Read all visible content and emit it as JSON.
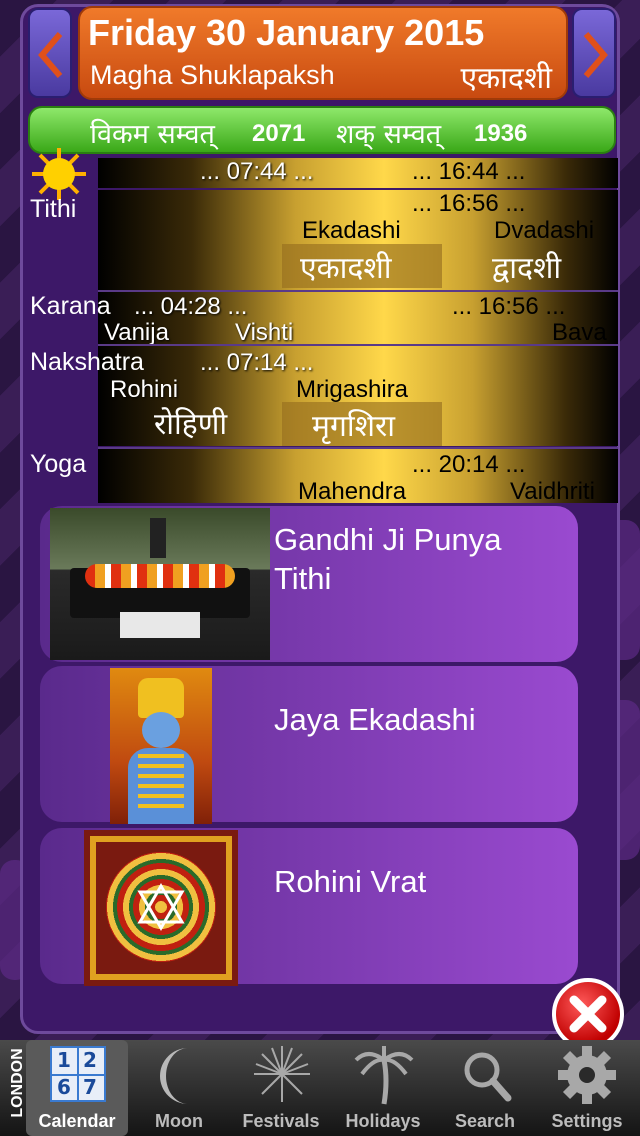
{
  "header": {
    "date": "Friday 30 January 2015",
    "paksha": "Magha Shuklapaksh",
    "tithi_hindi": "एकादशी",
    "samvat_vikram_label": "विकम सम्वत्",
    "samvat_vikram": "2071",
    "samvat_shak_label": "शक् सम्वत्",
    "samvat_shak": "1936"
  },
  "sun": {
    "rise": "... 07:44 ...",
    "set": "... 16:44 ..."
  },
  "tithi": {
    "label": "Tithi",
    "end_time": "... 16:56 ...",
    "current": "Ekadashi",
    "current_hindi": "एकादशी",
    "next": "Dvadashi",
    "next_hindi": "द्वादशी"
  },
  "karana": {
    "label": "Karana",
    "time1": "... 04:28 ...",
    "time2": "... 16:56 ...",
    "names": [
      "Vanija",
      "Vishti",
      "Bava"
    ]
  },
  "nakshatra": {
    "label": "Nakshatra",
    "end_time": "... 07:14 ...",
    "prev": "Rohini",
    "prev_hindi": "रोहिणी",
    "current": "Mrigashira",
    "current_hindi": "मृगशिरा"
  },
  "yoga": {
    "label": "Yoga",
    "end_time": "... 20:14 ...",
    "current": "Mahendra",
    "next": "Vaidhriti"
  },
  "events": [
    {
      "title_line1": "Gandhi Ji Punya",
      "title_line2": "Tithi",
      "image": "samadhi-photo"
    },
    {
      "title_line1": "Jaya Ekadashi",
      "title_line2": "",
      "image": "vishnu-picture"
    },
    {
      "title_line1": "Rohini Vrat",
      "title_line2": "",
      "image": "yantra-picture"
    }
  ],
  "location": "LONDON",
  "tabs": [
    {
      "label": "Calendar",
      "icon": "calendar-icon"
    },
    {
      "label": "Moon",
      "icon": "moon-icon"
    },
    {
      "label": "Festivals",
      "icon": "firework-icon"
    },
    {
      "label": "Holidays",
      "icon": "palm-tree-icon"
    },
    {
      "label": "Search",
      "icon": "search-icon"
    },
    {
      "label": "Settings",
      "icon": "gear-icon"
    }
  ],
  "calendar_icon_digits": [
    "1",
    "2",
    "6",
    "7"
  ],
  "colors": {
    "header": "#e0621e",
    "samvat": "#5cc83a",
    "card": "#7a3ab0",
    "close": "#e01010"
  }
}
